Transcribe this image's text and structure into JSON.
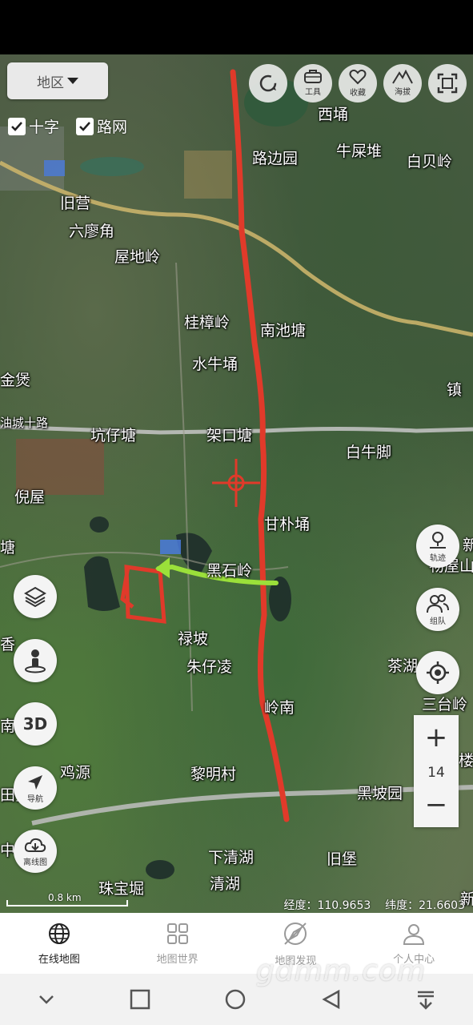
{
  "map": {
    "region_label": "地区",
    "layers": [
      {
        "label": "十字",
        "checked": true
      },
      {
        "label": "路网",
        "checked": true
      }
    ],
    "top_tools": [
      {
        "icon": "refresh-icon",
        "label": ""
      },
      {
        "icon": "toolbox-icon",
        "label": "工具"
      },
      {
        "icon": "heart-icon",
        "label": "收藏"
      },
      {
        "icon": "mountain-icon",
        "label": "海拔"
      },
      {
        "icon": "fullscreen-icon",
        "label": ""
      }
    ],
    "places": {
      "xitang": "西埇",
      "lubianyuan": "路边园",
      "niushidui": "牛屎堆",
      "baibeiling": "白贝岭",
      "jiuying": "旧营",
      "liuliaojiao": "六廖角",
      "wudiling": "屋地岭",
      "guizhangling": "桂樟岭",
      "nanchitang": "南池塘",
      "shuiniuyong": "水牛埇",
      "jinbao": "金煲",
      "zhen": "镇",
      "youchengshilu": "油城十路",
      "kengzaitang": "坑仔塘",
      "jiakoutang": "架口塘",
      "bainiujiao": "白牛脚",
      "niwu": "倪屋",
      "ganpuyong": "甘朴埇",
      "tang": "塘",
      "heishiling": "黑石岭",
      "xin": "新",
      "wuwushan": "物屋山",
      "lupo": "禄坡",
      "xiang": "香",
      "zhuzailing": "朱仔凌",
      "chahu": "茶湖",
      "lingnan": "岭南",
      "sangtaling": "三台岭",
      "nan": "南",
      "lou": "楼",
      "jiyuan": "鸡源",
      "limingcun": "黎明村",
      "heipoyuan": "黑坡园",
      "tiantou": "田头",
      "zhong": "中",
      "xiaqinghu": "下清湖",
      "jiubao": "旧堡",
      "qinghu": "清湖",
      "zhubaojue": "珠宝堀",
      "xin2": "新"
    },
    "side_left": [
      {
        "icon": "layers-icon",
        "label": ""
      },
      {
        "icon": "street-view-icon",
        "label": ""
      },
      {
        "icon": "3d-icon",
        "label": "3D"
      },
      {
        "icon": "navigation-icon",
        "label": "导航"
      },
      {
        "icon": "offline-map-icon",
        "label": "离线图"
      }
    ],
    "side_right": [
      {
        "icon": "track-icon",
        "label": "轨迹"
      },
      {
        "icon": "team-icon",
        "label": "组队"
      },
      {
        "icon": "locate-icon",
        "label": ""
      }
    ],
    "zoom_level": "14",
    "zoom_in": "+",
    "zoom_out": "−",
    "scale_label": "0.8 km",
    "coords": {
      "lon_label": "经度：",
      "lon_value": "110.9653",
      "lat_label": "纬度：",
      "lat_value": "21.6603"
    }
  },
  "bottom_nav": [
    {
      "label": "在线地图",
      "active": true
    },
    {
      "label": "地图世界",
      "active": false
    },
    {
      "label": "地图发现",
      "active": false
    },
    {
      "label": "个人中心",
      "active": false
    }
  ],
  "watermark": "gdmm.com"
}
